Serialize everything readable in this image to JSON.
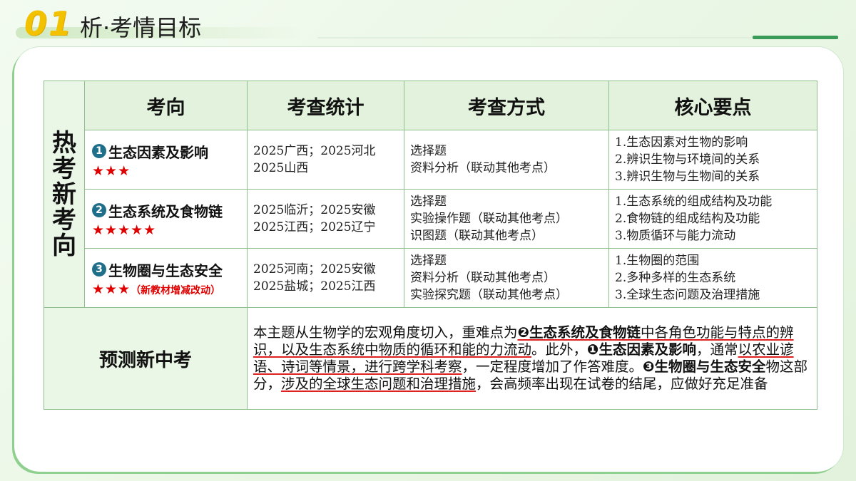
{
  "header": {
    "number": "01",
    "title": "析·考情目标"
  },
  "table": {
    "side_label": "热考新考向",
    "columns": [
      "考向",
      "考查统计",
      "考查方式",
      "核心要点"
    ],
    "rows": [
      {
        "num": "❶",
        "name": "生态因素及影响",
        "stars": "★★★",
        "note": "",
        "stats": "2025广西；2025河北\n2025山西",
        "ways": "选择题\n资料分析（联动其他考点）",
        "points": "1.生态因素对生物的影响\n2.辨识生物与环境间的关系\n3.辨识生物与生物间的关系"
      },
      {
        "num": "❷",
        "name": "生态系统及食物链",
        "stars": "★★★★★",
        "note": "",
        "stats": "2025临沂；2025安徽\n2025江西；2025辽宁",
        "ways": "选择题\n实验操作题（联动其他考点）\n识图题（联动其他考点）",
        "points": "1.生态系统的组成结构及功能\n2.食物链的组成结构及功能\n3.物质循环与能力流动"
      },
      {
        "num": "❸",
        "name": "生物圈与生态安全",
        "stars": "★★★",
        "note": "（新教材增减改动）",
        "stats": "2025河南；2025安徽\n2025盐城；2025江西",
        "ways": "选择题\n资料分析（联动其他考点）\n实验探究题（联动其他考点）",
        "points": "1.生物圈的范围\n2.多种多样的生态系统\n3.全球生态问题及治理措施"
      }
    ],
    "predict_label": "预测新中考",
    "predict": {
      "p1": "本主题从生物学的宏观角度切入，重难点为",
      "b1": "❷生态系统及食物链",
      "p2": "中各角色功能与特点的辨识，以及生态系统中物质的循环和能的力流动",
      "p3": "。此外，",
      "b2": "❶生态因素及影响",
      "p4": "，通常",
      "p5": "以农业谚语、诗词等情景，进行跨学科考察",
      "p6": "，一定程度增加了作答难度。",
      "b3": "❸生物圈与生态安全",
      "p7": "物这部分，",
      "p8": "涉及的全球生态问题和治理措施",
      "p9": "，会高频率出现在试卷的结尾，应做好充足准备"
    }
  }
}
